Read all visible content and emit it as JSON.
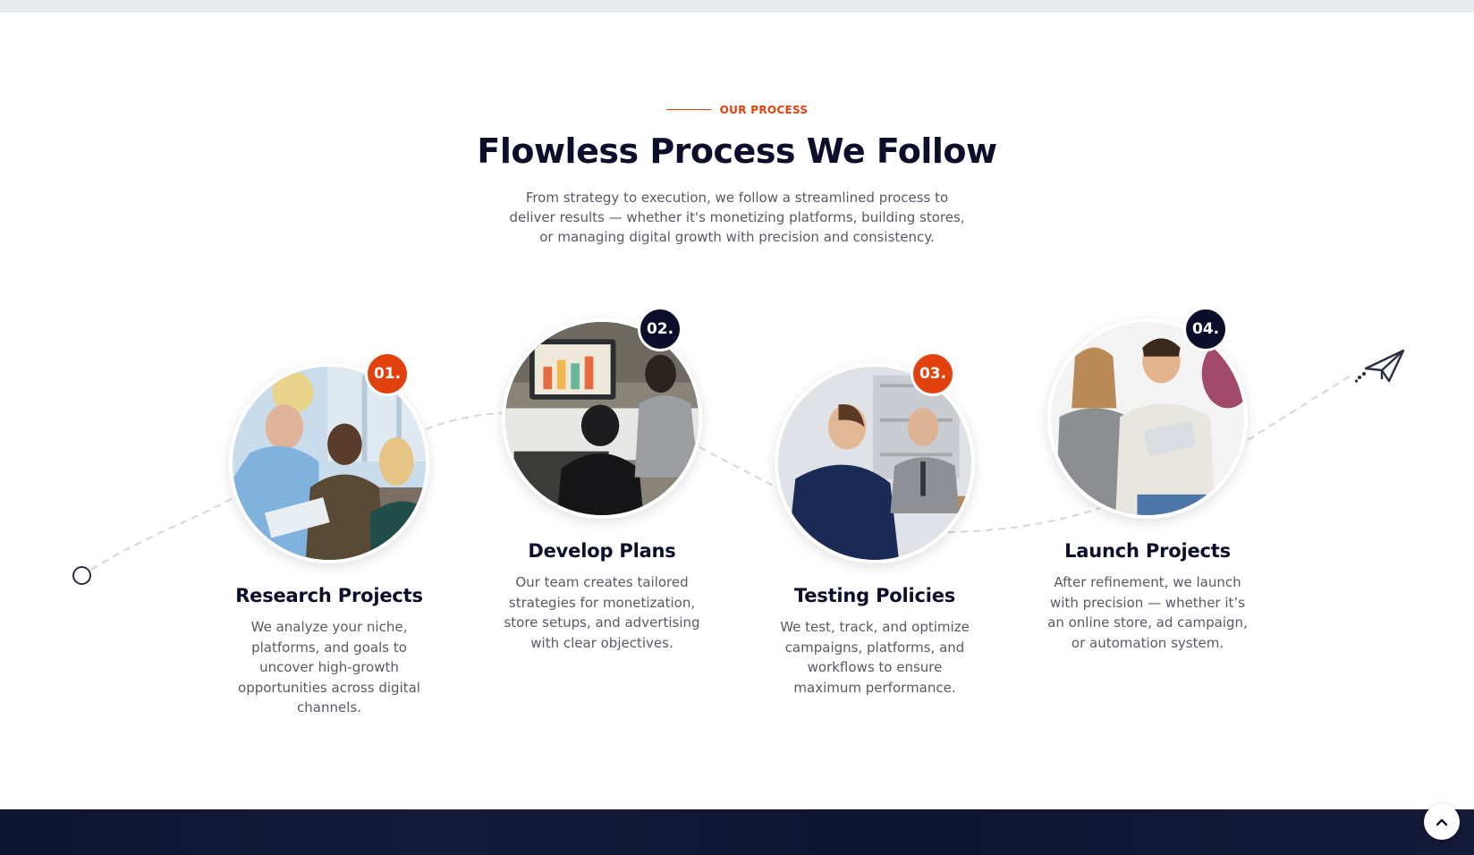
{
  "section": {
    "eyebrow": "OUR PROCESS",
    "title": "Flowless Process We Follow",
    "subtitle": "From strategy to execution, we follow a streamlined process to deliver results — whether it's monetizing platforms, building stores, or managing digital growth with precision and consistency."
  },
  "steps": [
    {
      "number": "01.",
      "title": "Research Projects",
      "description": "We analyze your niche, platforms, and goals to uncover high-growth opportunities across digital channels.",
      "badge_color": "#e2410e"
    },
    {
      "number": "02.",
      "title": "Develop Plans",
      "description": "Our team creates tailored strategies for monetization, store setups, and advertising with clear objectives.",
      "badge_color": "#0b0f2b"
    },
    {
      "number": "03.",
      "title": "Testing Policies",
      "description": "We test, track, and optimize campaigns, platforms, and workflows to ensure maximum performance.",
      "badge_color": "#e2410e"
    },
    {
      "number": "04.",
      "title": "Launch Projects",
      "description": "After refinement, we launch with precision — whether it’s an online store, ad campaign, or automation system.",
      "badge_color": "#0b0f2b"
    }
  ],
  "icons": {
    "start": "circle-outline-icon",
    "end": "paper-plane-icon",
    "scroll_top": "chevron-up-icon"
  },
  "colors": {
    "accent": "#e2410e",
    "navy": "#0b0f2b",
    "text_muted": "#555a66"
  }
}
